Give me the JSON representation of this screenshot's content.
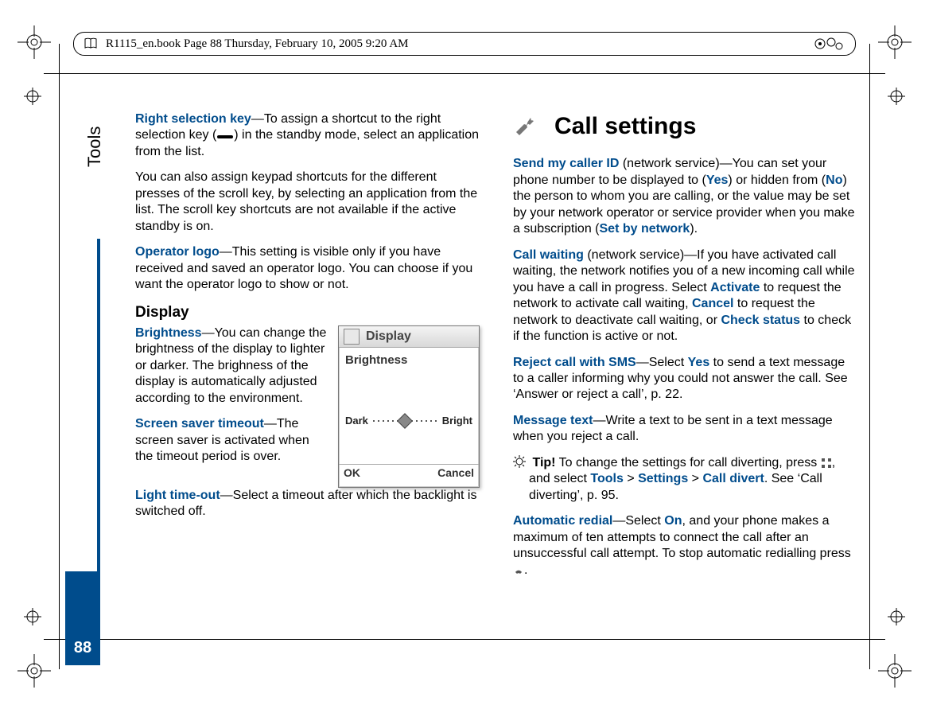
{
  "header": {
    "text": "R1115_en.book  Page 88  Thursday, February 10, 2005  9:20 AM"
  },
  "side": {
    "label": "Tools",
    "page_number": "88"
  },
  "left_col": {
    "p1_key": "Right selection key",
    "p1_rest_a": "—To assign a shortcut to the right selection key (",
    "p1_rest_b": ") in the standby mode, select an application from the list.",
    "p2": "You can also assign keypad shortcuts for the different presses of the scroll key, by selecting an application from the list. The scroll key shortcuts are not available if the active standby is on.",
    "p3_key": "Operator logo",
    "p3_rest": "—This setting is visible only if you have received and saved an operator logo. You can choose if you want the operator logo to show or not.",
    "display_heading": "Display",
    "brightness_key": "Brightness",
    "brightness_rest": "—You can change the brightness of the display to lighter or darker. The brighness of the display is automatically adjusted according to the environment.",
    "sst_key": "Screen saver timeout",
    "sst_rest": "—The screen saver is activated when the timeout period is over.",
    "lto_key": "Light time-out",
    "lto_rest": "—Select a timeout after which the backlight is switched off."
  },
  "phone": {
    "title": "Display",
    "label": "Brightness",
    "left": "Dark",
    "right": "Bright",
    "sk_left": "OK",
    "sk_right": "Cancel"
  },
  "right_col": {
    "section_title": "Call settings",
    "p1_key": "Send my caller ID",
    "p1_a": " (network service)—You can set your phone number to be displayed to (",
    "p1_yes": "Yes",
    "p1_b": ") or hidden from (",
    "p1_no": "No",
    "p1_c": ") the person to whom you are calling, or the value may be set by your network operator or service provider when you make a subscription (",
    "p1_sbn": "Set by network",
    "p1_d": ").",
    "p2_key": "Call waiting",
    "p2_a": " (network service)—If you have activated call waiting, the network notifies you of a new incoming call while you have a call in progress. Select ",
    "p2_act": "Activate",
    "p2_b": " to request the network to activate call waiting, ",
    "p2_can": "Cancel",
    "p2_c": " to request the network to deactivate call waiting, or ",
    "p2_chk": "Check status",
    "p2_d": " to check if the function is active or not.",
    "p3_key": "Reject call with SMS",
    "p3_a": "—Select ",
    "p3_yes": "Yes",
    "p3_b": " to send a text message to a caller informing why you could not answer the call. See ‘Answer or reject a call’, p. 22.",
    "p4_key": "Message text",
    "p4_rest": "—Write a text to be sent in a text message when you reject a call.",
    "tip_label": "Tip!",
    "tip_a": " To change the settings for call diverting, press ",
    "tip_b": ", and select ",
    "tip_tools": "Tools",
    "tip_gt1": " > ",
    "tip_settings": "Settings",
    "tip_gt2": " > ",
    "tip_cd": "Call divert",
    "tip_c": ". See ‘Call diverting’, p. 95.",
    "p5_key": "Automatic redial",
    "p5_a": "—Select ",
    "p5_on": "On",
    "p5_b": ", and your phone makes a maximum of ten attempts to connect the call after an unsuccessful call attempt. To stop automatic redialling press ",
    "p5_c": "."
  }
}
